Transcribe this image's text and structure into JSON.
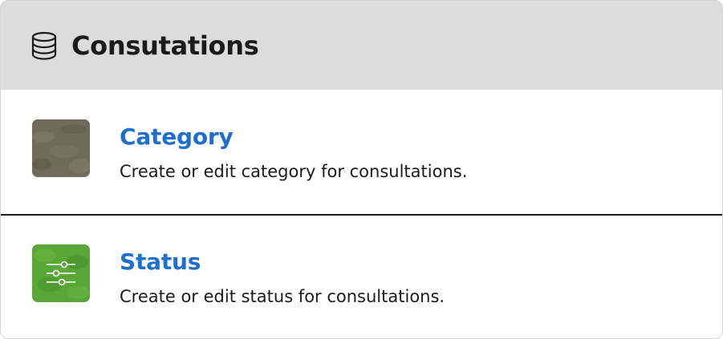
{
  "header": {
    "icon": "database-icon",
    "title": "Consutations"
  },
  "items": [
    {
      "icon": "category-thumbnail",
      "title": "Category",
      "description": "Create or edit category for consultations.",
      "color": "#6f6a5a"
    },
    {
      "icon": "sliders-icon",
      "title": "Status",
      "description": "Create or edit status for consultations.",
      "color": "#5aa637"
    }
  ],
  "colors": {
    "header_bg": "#dcdcdc",
    "link": "#1f6fd1",
    "text": "#1b1b1b"
  }
}
